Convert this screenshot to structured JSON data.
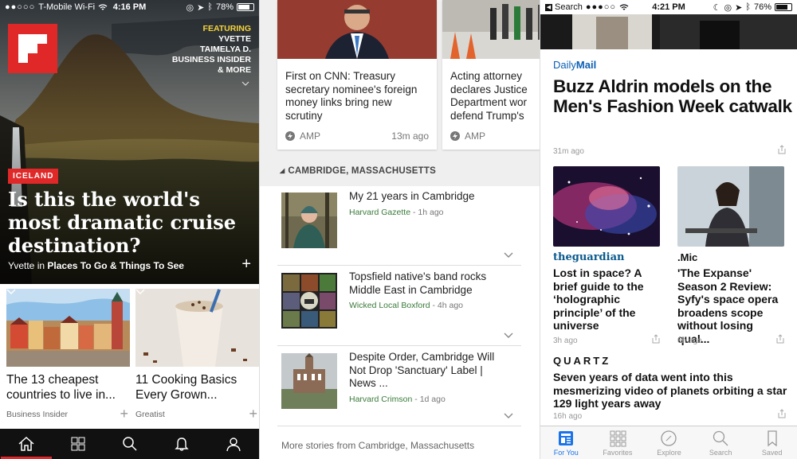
{
  "panel_flipboard": {
    "status": {
      "carrier": "T-Mobile Wi-Fi",
      "time": "4:16 PM",
      "battery": "78%"
    },
    "featuring": {
      "label": "FEATURING",
      "names": [
        "YVETTE",
        "TAIMELYA D.",
        "BUSINESS INSIDER",
        "& MORE"
      ]
    },
    "hero": {
      "tag": "ICELAND",
      "title": "Is this the world's most dramatic cruise destination?",
      "byline_author": "Yvette",
      "byline_in": "in",
      "byline_magazine": "Places To Go & Things To See"
    },
    "cards": [
      {
        "title": "The 13 cheapest countries to live in...",
        "source": "Business Insider"
      },
      {
        "title": "11 Cooking Basics Every Grown...",
        "source": "Greatist"
      }
    ],
    "tabs": [
      "home-icon",
      "grid-icon",
      "search-icon",
      "bell-icon",
      "profile-icon"
    ],
    "accent": "#e12828"
  },
  "panel_news": {
    "top_cards": [
      {
        "title": "First on CNN: Treasury secretary nominee's foreign money links bring new scrutiny",
        "badge": "AMP",
        "time": "13m ago"
      },
      {
        "title": "Acting attorney declares Justice Department wor defend Trump's",
        "badge": "AMP",
        "time": ""
      }
    ],
    "section": "CAMBRIDGE, MASSACHUSETTS",
    "stories": [
      {
        "title": "My 21 years in Cambridge",
        "source": "Harvard Gazette",
        "time": "1h ago"
      },
      {
        "title": "Topsfield native's band rocks Middle East in Cambridge",
        "source": "Wicked Local Boxford",
        "time": "4h ago"
      },
      {
        "title": "Despite Order, Cambridge Will Not Drop 'Sanctuary' Label | News ...",
        "source": "Harvard Crimson",
        "time": "1d ago"
      }
    ],
    "more": "More stories from Cambridge, Massachusetts",
    "source_color": "#3a7a3a"
  },
  "panel_apple": {
    "status": {
      "back": "Search",
      "time": "4:21 PM",
      "battery": "76%"
    },
    "lead": {
      "publisher_a": "Daily",
      "publisher_b": "Mail",
      "title": "Buzz Aldrin models on the Men's Fashion Week catwalk",
      "time": "31m ago"
    },
    "tiles": [
      {
        "publisher": "theguardian",
        "title": "Lost in space? A brief guide to the ‘holographic principle’ of the universe",
        "time": "3h ago"
      },
      {
        "publisher": ".Mic",
        "title": "'The Expanse' Season 2 Review: Syfy's space opera broadens scope without losing qual...",
        "time": "6h ago"
      }
    ],
    "quartz": {
      "publisher": "QUARTZ",
      "title": "Seven years of data went into this mesmerizing video of planets orbiting a star 129 light years away",
      "time": "16h ago"
    },
    "tabs": [
      "For You",
      "Favorites",
      "Explore",
      "Search",
      "Saved"
    ],
    "accent": "#1a73e8"
  }
}
